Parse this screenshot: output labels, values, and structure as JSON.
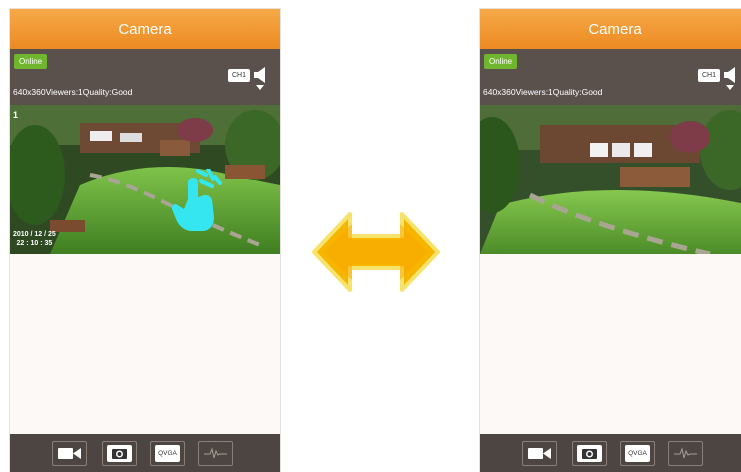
{
  "screens": [
    {
      "title": "Camera",
      "status": "Online",
      "channel": "CH1",
      "stream_info": "640x360Viewers:1Quality:Good",
      "video": {
        "channel_number": "1",
        "timestamp_date": "2010 / 12 / 25",
        "timestamp_time": "22 : 10 : 35"
      },
      "toolbar": {
        "record": "video-camera-icon",
        "snapshot": "camera-icon",
        "resolution_label": "QVGA",
        "audio": "waveform-icon"
      }
    },
    {
      "title": "Camera",
      "status": "Online",
      "channel": "CH1",
      "stream_info": "640x360Viewers:1Quality:Good",
      "toolbar": {
        "record": "video-camera-icon",
        "snapshot": "camera-icon",
        "resolution_label": "QVGA",
        "audio": "waveform-icon"
      }
    }
  ],
  "colors": {
    "title_bar": "#ec8a22",
    "status_bar": "#5a514d",
    "online": "#70b52e",
    "toolbar": "#4d4541",
    "swap_arrow": "#f7b500",
    "gesture": "#35e6f0"
  }
}
